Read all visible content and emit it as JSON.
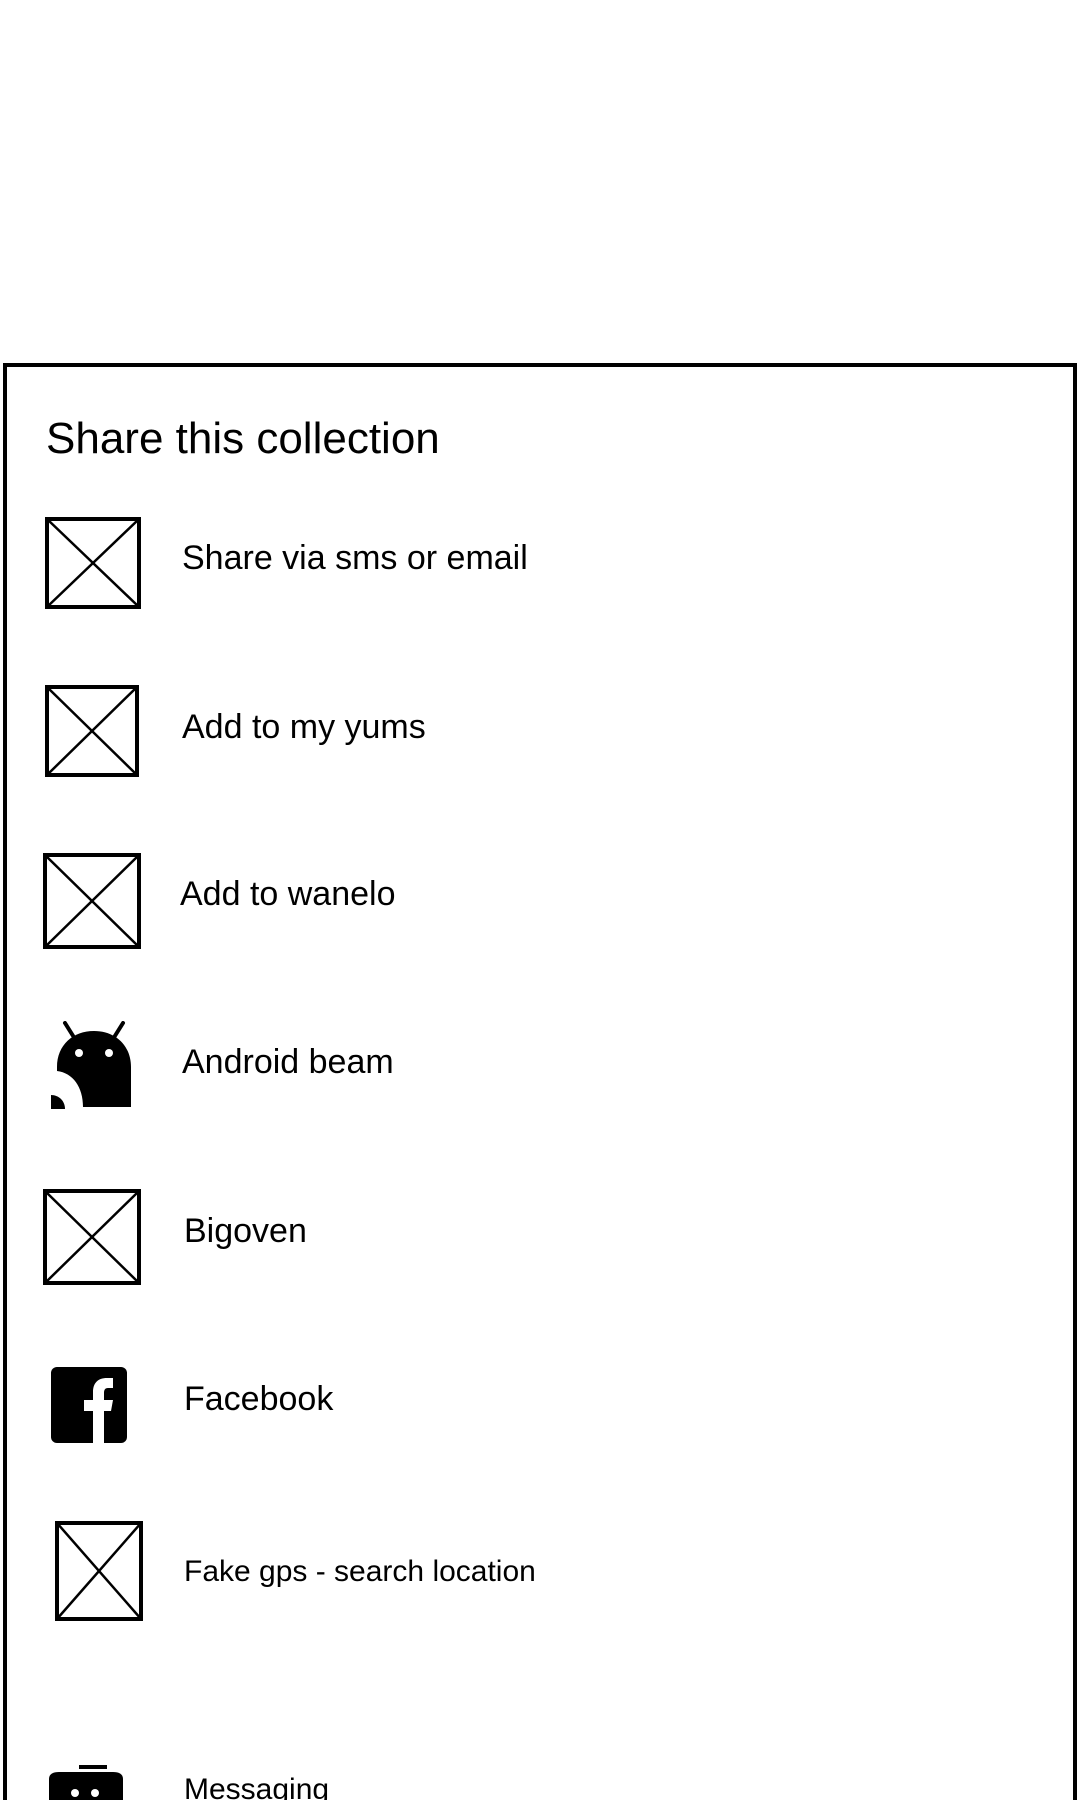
{
  "share_sheet": {
    "title": "Share this collection",
    "items": [
      {
        "label": "Share via sms or email",
        "icon": "placeholder-icon"
      },
      {
        "label": "Add to my yums",
        "icon": "placeholder-icon"
      },
      {
        "label": "Add to wanelo",
        "icon": "placeholder-icon"
      },
      {
        "label": "Android beam",
        "icon": "android-beam-icon"
      },
      {
        "label": "Bigoven",
        "icon": "placeholder-icon"
      },
      {
        "label": "Facebook",
        "icon": "facebook-icon"
      },
      {
        "label": "Fake gps - search location",
        "icon": "placeholder-icon"
      },
      {
        "label": "Messaging",
        "icon": "messaging-icon"
      }
    ]
  },
  "colors": {
    "background": "#ffffff",
    "foreground": "#000000"
  }
}
